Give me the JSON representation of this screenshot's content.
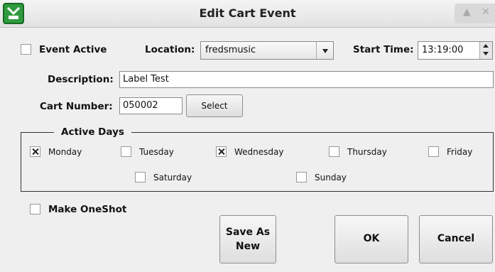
{
  "window": {
    "title": "Edit Cart Event",
    "controls": [
      "▲",
      "✕"
    ]
  },
  "event_active": {
    "label": "Event Active",
    "checked": true
  },
  "location": {
    "label": "Location:",
    "value": "fredsmusic"
  },
  "start_time": {
    "label": "Start Time:",
    "value": "13:19:00"
  },
  "description": {
    "label": "Description:",
    "value": "Label Test"
  },
  "cart_number": {
    "label": "Cart Number:",
    "value": "050002",
    "select_label": "Select"
  },
  "active_days": {
    "title": "Active Days",
    "days": [
      {
        "label": "Monday",
        "checked": true
      },
      {
        "label": "Tuesday",
        "checked": false
      },
      {
        "label": "Wednesday",
        "checked": true
      },
      {
        "label": "Thursday",
        "checked": false
      },
      {
        "label": "Friday",
        "checked": false
      },
      {
        "label": "Saturday",
        "checked": false
      },
      {
        "label": "Sunday",
        "checked": false
      }
    ]
  },
  "make_oneshot": {
    "label": "Make OneShot",
    "checked": false
  },
  "buttons": {
    "save_as_new_line1": "Save As",
    "save_as_new_line2": "New",
    "ok": "OK",
    "cancel": "Cancel"
  }
}
